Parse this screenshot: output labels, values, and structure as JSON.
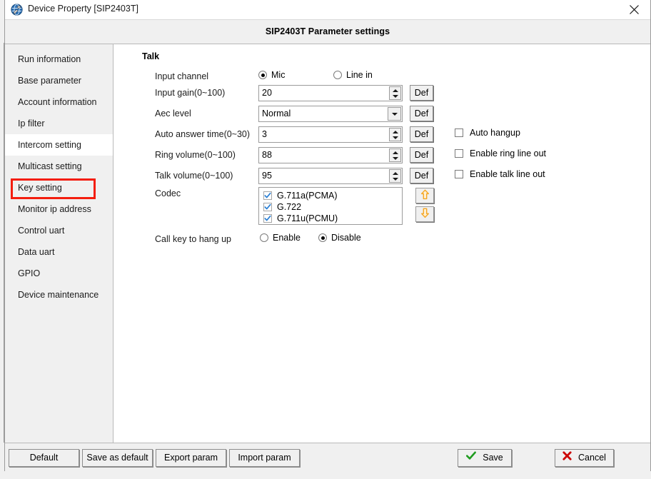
{
  "window": {
    "title": "Device Property [SIP2403T]",
    "app_icon": "network-tools-icon",
    "close_icon": "close-icon"
  },
  "header": {
    "title": "SIP2403T Parameter settings"
  },
  "sidebar": {
    "items": [
      {
        "label": "Run information",
        "selected": false
      },
      {
        "label": "Base parameter",
        "selected": false
      },
      {
        "label": "Account information",
        "selected": false
      },
      {
        "label": "Ip filter",
        "selected": false
      },
      {
        "label": "Intercom setting",
        "selected": true
      },
      {
        "label": "Multicast setting",
        "selected": false
      },
      {
        "label": "Key setting",
        "selected": false
      },
      {
        "label": "Monitor ip address",
        "selected": false
      },
      {
        "label": "Control uart",
        "selected": false
      },
      {
        "label": "Data uart",
        "selected": false
      },
      {
        "label": "GPIO",
        "selected": false
      },
      {
        "label": "Device maintenance",
        "selected": false
      }
    ],
    "highlight_color": "#f41d0e"
  },
  "form": {
    "group_title": "Talk",
    "input_channel": {
      "label": "Input channel",
      "options": [
        {
          "label": "Mic",
          "checked": true
        },
        {
          "label": "Line in",
          "checked": false
        }
      ]
    },
    "input_gain": {
      "label": "Input gain(0~100)",
      "value": "20",
      "def_label": "Def"
    },
    "aec_level": {
      "label": "Aec level",
      "value": "Normal",
      "def_label": "Def"
    },
    "auto_answer_time": {
      "label": "Auto answer time(0~30)",
      "value": "3",
      "def_label": "Def"
    },
    "ring_volume": {
      "label": "Ring volume(0~100)",
      "value": "88",
      "def_label": "Def"
    },
    "talk_volume": {
      "label": "Talk volume(0~100)",
      "value": "95",
      "def_label": "Def"
    },
    "codec": {
      "label": "Codec",
      "items": [
        {
          "label": "G.711a(PCMA)",
          "checked": true
        },
        {
          "label": "G.722",
          "checked": true
        },
        {
          "label": "G.711u(PCMU)",
          "checked": true
        }
      ],
      "move_up_icon": "arrow-up-icon",
      "move_down_icon": "arrow-down-icon",
      "arrow_color": "#f5a623"
    },
    "call_key_hangup": {
      "label": "Call key to hang up",
      "options": [
        {
          "label": "Enable",
          "checked": false
        },
        {
          "label": "Disable",
          "checked": true
        }
      ]
    },
    "checkboxes": [
      {
        "label": "Auto hangup",
        "checked": false
      },
      {
        "label": "Enable ring line out",
        "checked": false
      },
      {
        "label": "Enable talk line out",
        "checked": false
      }
    ]
  },
  "footer": {
    "default_label": "Default",
    "save_as_default_label": "Save as default",
    "export_param_label": "Export param",
    "import_param_label": "Import param",
    "save_label": "Save",
    "cancel_label": "Cancel",
    "save_icon": "check-icon",
    "cancel_icon": "cross-icon",
    "save_icon_color": "#1f9c1f",
    "cancel_icon_color": "#cc0000"
  }
}
